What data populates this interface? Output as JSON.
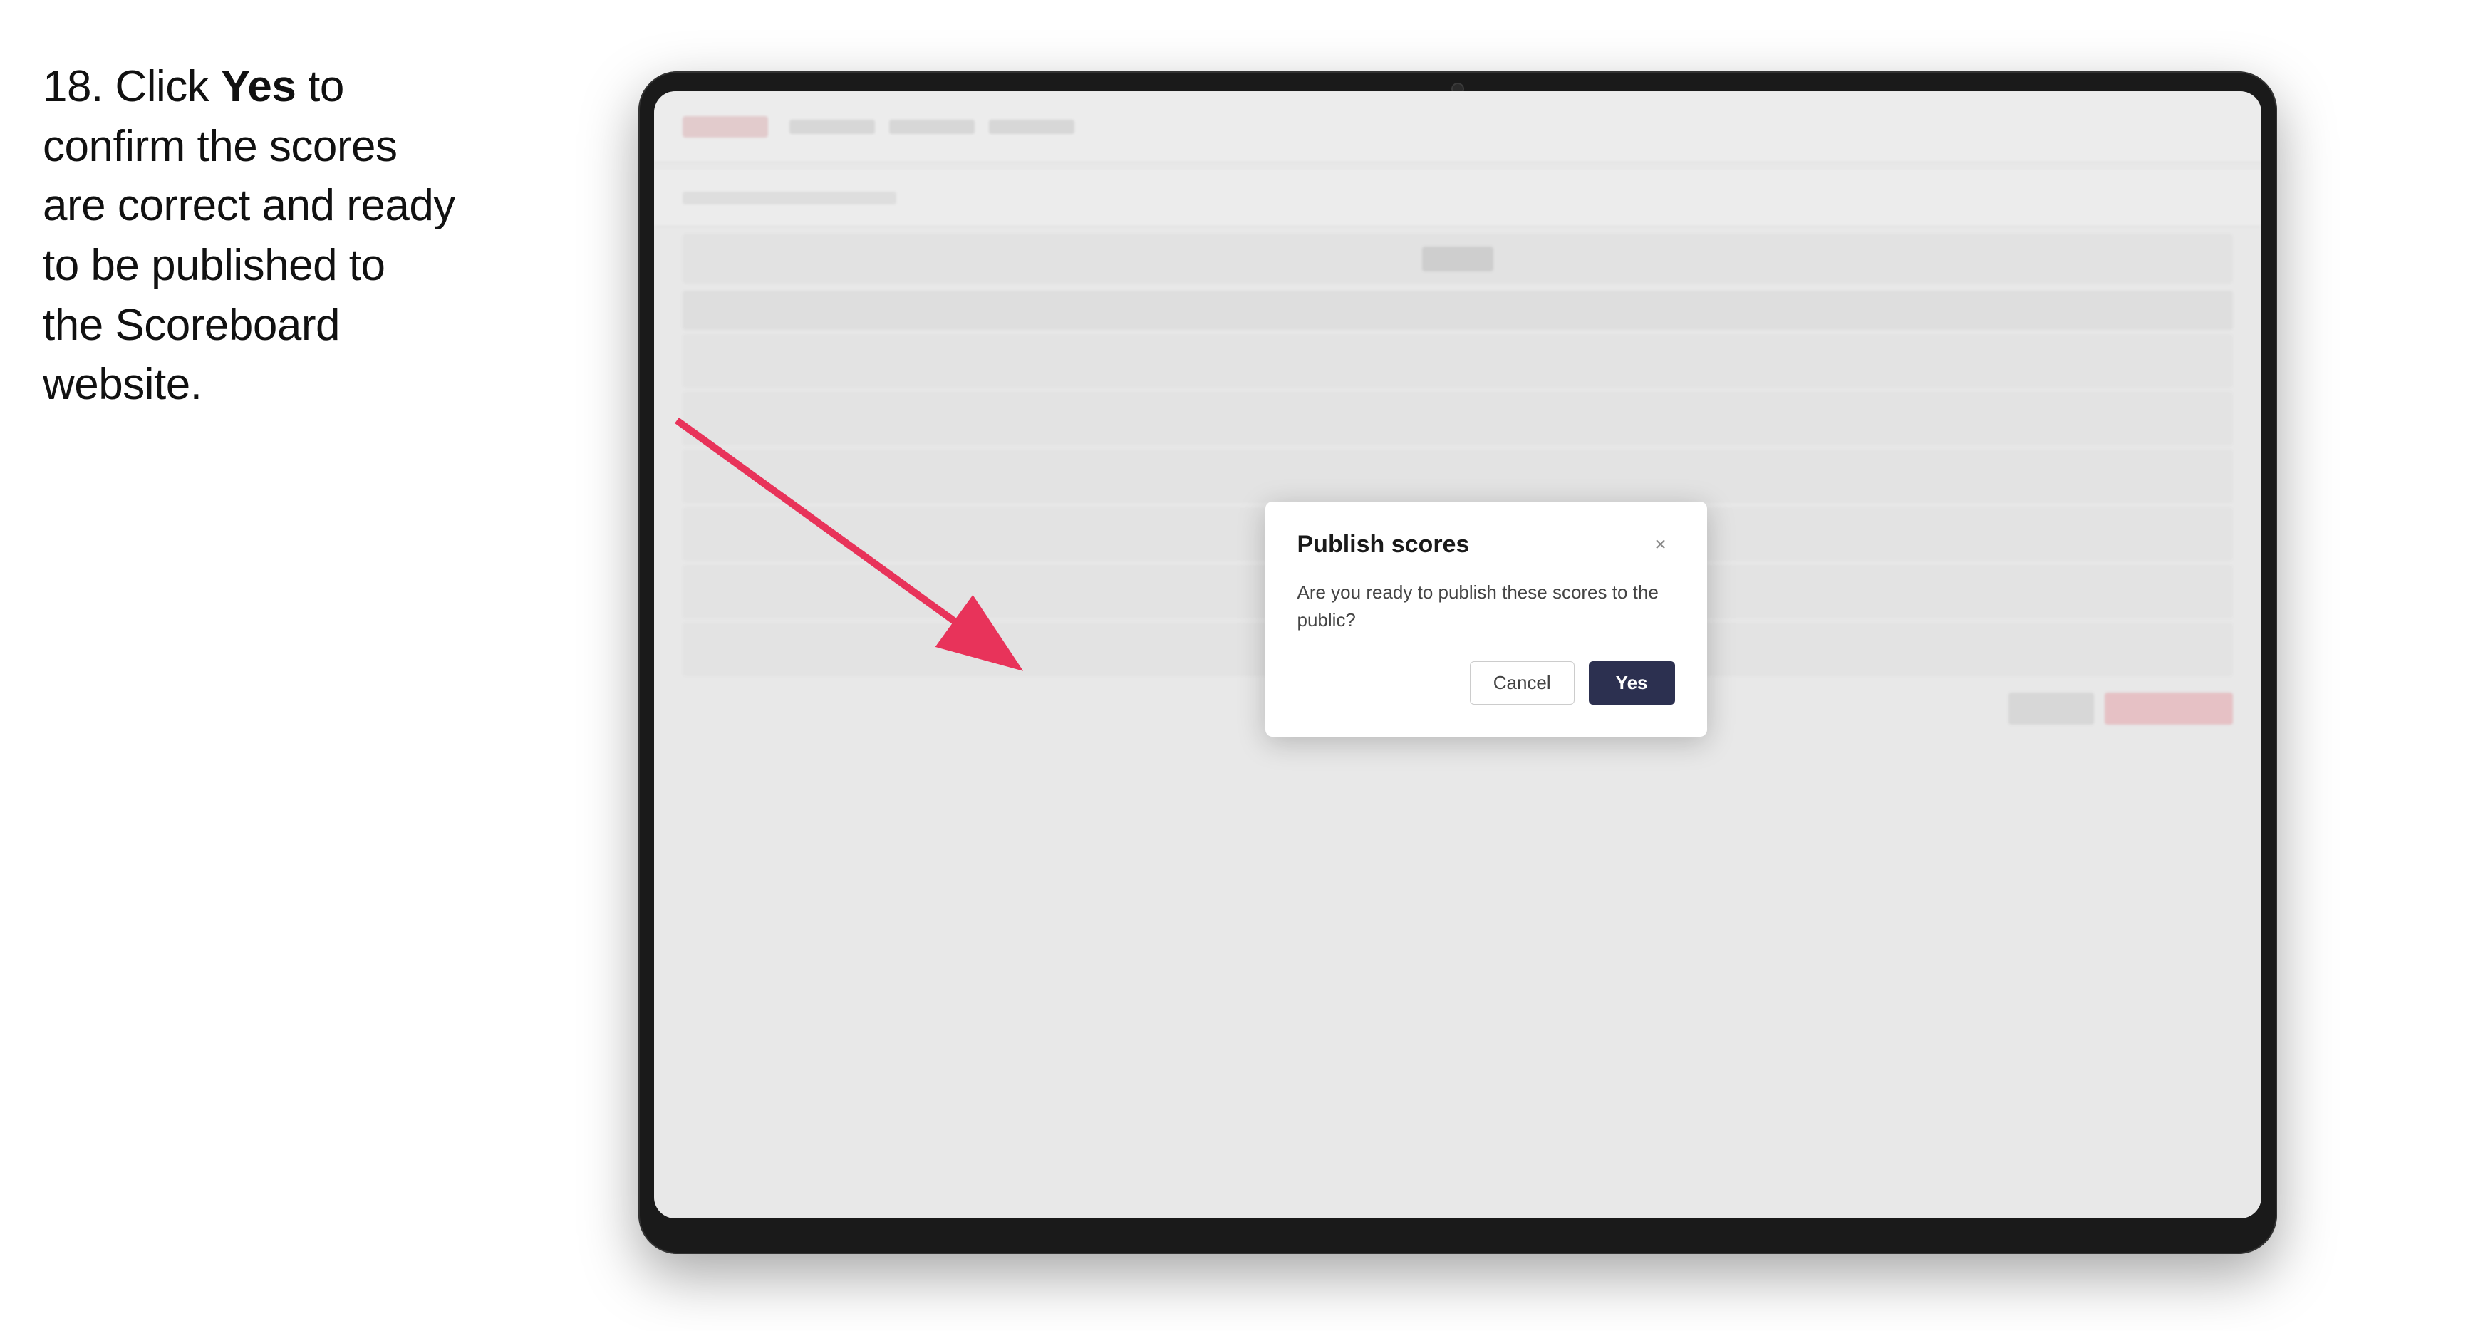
{
  "instruction": {
    "step_number": "18.",
    "text_plain": " Click ",
    "text_bold": "Yes",
    "text_rest": " to confirm the scores are correct and ready to be published to the Scoreboard website."
  },
  "tablet": {
    "aria_label": "Tablet device showing scoreboard application"
  },
  "modal": {
    "title": "Publish scores",
    "body_text": "Are you ready to publish these scores to the public?",
    "cancel_label": "Cancel",
    "yes_label": "Yes",
    "close_icon": "×"
  },
  "arrow": {
    "description": "Arrow pointing from instruction text to modal dialog"
  }
}
